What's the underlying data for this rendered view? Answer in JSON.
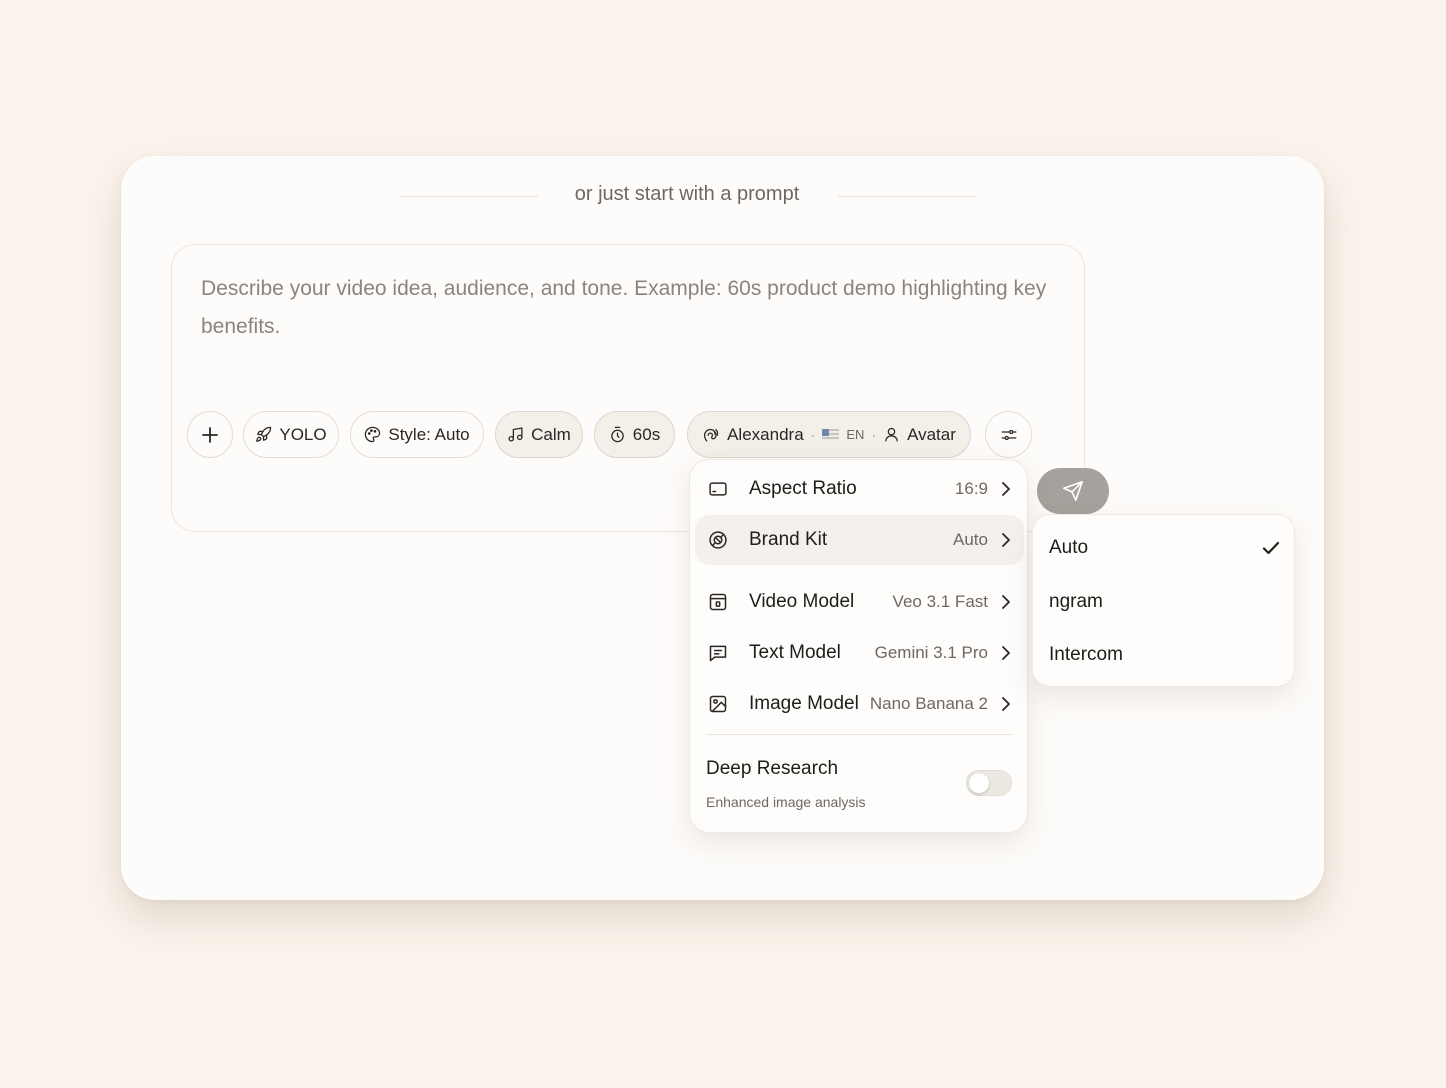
{
  "divider": {
    "text": "or just start with a prompt"
  },
  "prompt": {
    "placeholder": "Describe your video idea, audience, and tone. Example: 60s product demo highlighting key benefits."
  },
  "toolbar": {
    "add_icon": "plus-icon",
    "yolo_label": "YOLO",
    "style_label": "Style: Auto",
    "music_label": "Calm",
    "duration_label": "60s",
    "voice": {
      "name": "Alexandra",
      "separator": "·",
      "language": "EN",
      "avatar_label": "Avatar"
    },
    "settings_icon": "sliders-icon",
    "send_icon": "send-icon"
  },
  "settings_menu": {
    "items": [
      {
        "label": "Aspect Ratio",
        "value": "16:9",
        "icon": "aspect-ratio-icon"
      },
      {
        "label": "Brand Kit",
        "value": "Auto",
        "icon": "brand-kit-icon"
      },
      {
        "label": "Video Model",
        "value": "Veo 3.1 Fast",
        "icon": "video-model-icon"
      },
      {
        "label": "Text Model",
        "value": "Gemini 3.1 Pro",
        "icon": "text-model-icon"
      },
      {
        "label": "Image Model",
        "value": "Nano Banana 2",
        "icon": "image-model-icon"
      }
    ],
    "deep_research": {
      "title": "Deep Research",
      "subtitle": "Enhanced image analysis",
      "enabled": false
    }
  },
  "brand_kit_submenu": {
    "options": [
      {
        "label": "Auto",
        "selected": true
      },
      {
        "label": "ngram",
        "selected": false
      },
      {
        "label": "Intercom",
        "selected": false
      }
    ]
  },
  "colors": {
    "background": "#fbf4ec",
    "card": "#fefcfa",
    "send_button": "#a5a19c"
  }
}
